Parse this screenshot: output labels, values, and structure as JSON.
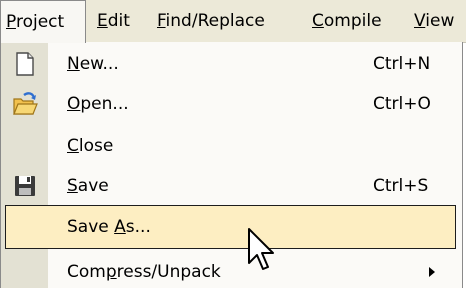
{
  "menubar": {
    "items": [
      {
        "prefix": "",
        "mnemonic": "P",
        "rest": "roject"
      },
      {
        "prefix": "",
        "mnemonic": "E",
        "rest": "dit"
      },
      {
        "prefix": "",
        "mnemonic": "F",
        "rest": "ind/Replace"
      },
      {
        "prefix": "",
        "mnemonic": "C",
        "rest": "ompile"
      },
      {
        "prefix": "",
        "mnemonic": "V",
        "rest": "iew"
      }
    ]
  },
  "project_menu": {
    "items": [
      {
        "prefix": "",
        "mnemonic": "N",
        "rest": "ew...",
        "shortcut": "Ctrl+N",
        "icon": "new-file-icon"
      },
      {
        "prefix": "",
        "mnemonic": "O",
        "rest": "pen...",
        "shortcut": "Ctrl+O",
        "icon": "open-folder-icon"
      },
      {
        "prefix": "",
        "mnemonic": "C",
        "rest": "lose",
        "shortcut": "",
        "icon": ""
      },
      {
        "prefix": "",
        "mnemonic": "S",
        "rest": "ave",
        "shortcut": "Ctrl+S",
        "icon": "floppy-disk-icon"
      },
      {
        "prefix": "Save ",
        "mnemonic": "A",
        "rest": "s...",
        "shortcut": "",
        "icon": ""
      },
      {
        "prefix": "Com",
        "mnemonic": "p",
        "rest": "ress/Unpack",
        "shortcut": "",
        "icon": "",
        "has_submenu": true
      }
    ],
    "selected_index": 4
  },
  "colors": {
    "menubar_bg": "#ece9d8",
    "gutter_bg": "#e3e1d3",
    "highlight_bg": "#fdeec2"
  }
}
